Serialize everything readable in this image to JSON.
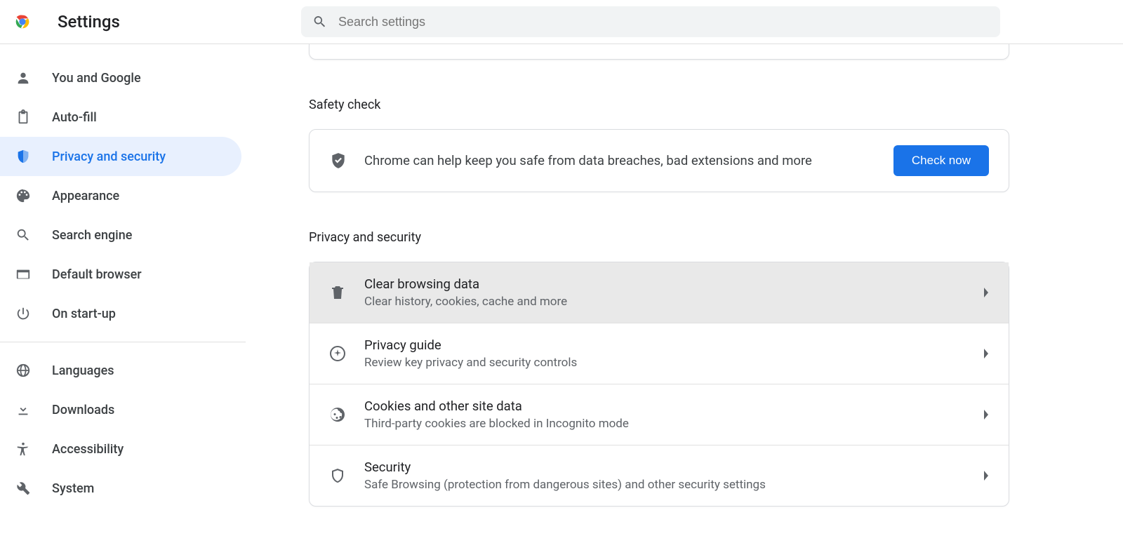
{
  "header": {
    "title": "Settings",
    "search_placeholder": "Search settings"
  },
  "sidebar": {
    "groups": [
      [
        {
          "icon": "person",
          "label": "You and Google",
          "active": false
        },
        {
          "icon": "clipboard",
          "label": "Auto-fill",
          "active": false
        },
        {
          "icon": "shield-half",
          "label": "Privacy and security",
          "active": true
        },
        {
          "icon": "palette",
          "label": "Appearance",
          "active": false
        },
        {
          "icon": "search",
          "label": "Search engine",
          "active": false
        },
        {
          "icon": "browser",
          "label": "Default browser",
          "active": false
        },
        {
          "icon": "power",
          "label": "On start-up",
          "active": false
        }
      ],
      [
        {
          "icon": "globe",
          "label": "Languages",
          "active": false
        },
        {
          "icon": "download",
          "label": "Downloads",
          "active": false
        },
        {
          "icon": "accessibility",
          "label": "Accessibility",
          "active": false
        },
        {
          "icon": "wrench",
          "label": "System",
          "active": false
        }
      ]
    ]
  },
  "main": {
    "safety_check": {
      "heading": "Safety check",
      "text": "Chrome can help keep you safe from data breaches, bad extensions and more",
      "button": "Check now"
    },
    "privacy_security": {
      "heading": "Privacy and security",
      "rows": [
        {
          "icon": "trash",
          "title": "Clear browsing data",
          "sub": "Clear history, cookies, cache and more",
          "hovered": true
        },
        {
          "icon": "compass",
          "title": "Privacy guide",
          "sub": "Review key privacy and security controls",
          "hovered": false
        },
        {
          "icon": "cookie",
          "title": "Cookies and other site data",
          "sub": "Third-party cookies are blocked in Incognito mode",
          "hovered": false
        },
        {
          "icon": "shield-outline",
          "title": "Security",
          "sub": "Safe Browsing (protection from dangerous sites) and other security settings",
          "hovered": false
        }
      ]
    }
  }
}
